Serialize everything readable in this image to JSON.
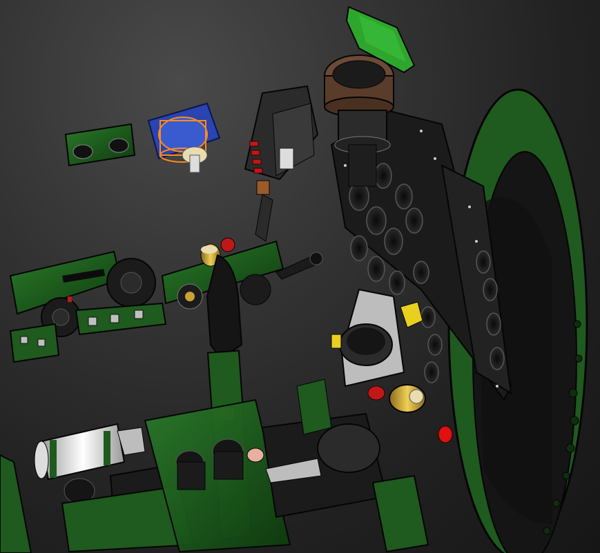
{
  "scene": {
    "colors": {
      "background": "#2a2a2a",
      "panel_green": "#1f5a1f",
      "panel_green_dark": "#123a12",
      "panel_black": "#1b1b1b",
      "edge": "#050505",
      "selection_orange": "#ff8c1a",
      "selection_blue": "#2a44b0",
      "brass": "#c9a233",
      "red": "#c01818",
      "cream": "#e8dcb0",
      "grey": "#bdbdbd",
      "brown": "#6b4a36"
    }
  }
}
